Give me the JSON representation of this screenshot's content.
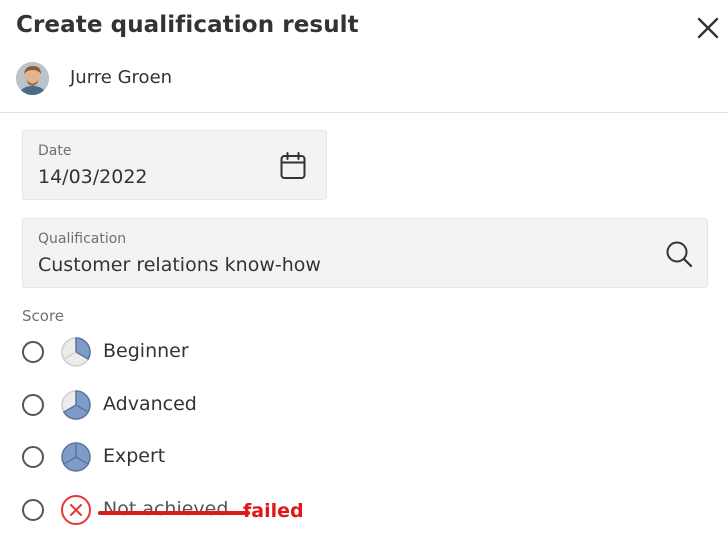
{
  "dialog": {
    "title": "Create qualification result"
  },
  "user": {
    "name": "Jurre Groen"
  },
  "date_field": {
    "label": "Date",
    "value": "14/03/2022",
    "icon": "calendar-icon"
  },
  "qualification_field": {
    "label": "Qualification",
    "value": "Customer relations know-how",
    "icon": "search-icon"
  },
  "score": {
    "label": "Score",
    "options": [
      {
        "label": "Beginner",
        "icon": "level-one-third-icon",
        "selected": false
      },
      {
        "label": "Advanced",
        "icon": "level-two-thirds-icon",
        "selected": false
      },
      {
        "label": "Expert",
        "icon": "level-full-icon",
        "selected": false
      },
      {
        "label": "Not achieved",
        "icon": "not-achieved-icon",
        "selected": false
      }
    ]
  },
  "annotation": {
    "text": "failed",
    "color": "#e01818"
  },
  "colors": {
    "level_fill": "#7f9cc7",
    "level_stroke": "#5a73a0",
    "not_achieved": "#e53935"
  }
}
